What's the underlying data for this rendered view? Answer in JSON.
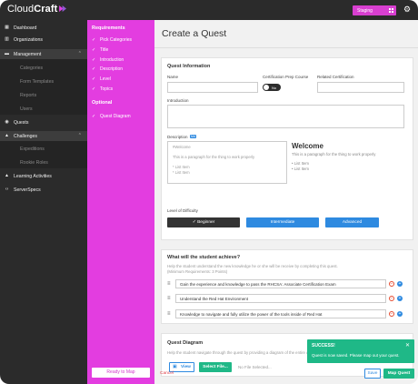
{
  "app": {
    "logo_light": "Cloud",
    "logo_bold": "Craft",
    "environment": "Staging",
    "colors": {
      "accent": "#e33de0",
      "primary": "#2e8ae0",
      "success": "#1fb887"
    }
  },
  "sidebar": {
    "items": [
      {
        "label": "Dashboard",
        "icon": "dashboard-icon"
      },
      {
        "label": "Organizations",
        "icon": "building-icon"
      },
      {
        "label": "Management",
        "icon": "folder-icon"
      },
      {
        "label": "Categories"
      },
      {
        "label": "Form Templates"
      },
      {
        "label": "Reports"
      },
      {
        "label": "Users"
      },
      {
        "label": "Quests",
        "icon": "compass-icon"
      },
      {
        "label": "Challenges",
        "icon": "mountain-icon"
      },
      {
        "label": "Expeditions"
      },
      {
        "label": "Rookie Roles"
      },
      {
        "label": "Learning Activities",
        "icon": "triangle-icon"
      },
      {
        "label": "ServerSpecs",
        "icon": "code-icon"
      }
    ]
  },
  "requirements": {
    "title": "Requirements",
    "items": [
      "Pick Categories",
      "Title",
      "Introduction",
      "Description",
      "Level",
      "Topics"
    ],
    "optional_title": "Optional",
    "optional_items": [
      "Quest Diagram"
    ],
    "ready_button": "Ready to Map"
  },
  "page": {
    "title": "Create a Quest"
  },
  "quest_info": {
    "heading": "Quest Information",
    "name_label": "Name",
    "cert_prep_label": "Certification Prep Course",
    "toggle_value": "No",
    "related_cert_label": "Related Certification",
    "intro_label": "Introduction",
    "description_label": "Description",
    "md_badge": "Md",
    "editor_lines": [
      "#Welcome",
      "This is a paragraph for the thing to work properly",
      "* List Item",
      "* List Item"
    ],
    "preview_heading": "Welcome",
    "preview_para": "This is a paragraph for the thing to work properly",
    "preview_list": [
      "• List Item",
      "• List Item"
    ],
    "level_label": "Level of Difficulty",
    "levels": [
      "Beginner",
      "Intermediate",
      "Advanced"
    ],
    "selected_level": "Beginner"
  },
  "achieve": {
    "heading": "What will the student achieve?",
    "help": "Help the student understand the new knowledge he or she will be receive by completing this quest.",
    "help2": "(Minimum Requirements: 3 Points)",
    "items": [
      "Gain the experience and knowledge to pass the RHCSA: Associate Certification Exam",
      "Understand the Red Hat Environment",
      "Knowledge to navigate and fully utilize the power of the tools inside of Red Hat"
    ]
  },
  "diagram": {
    "heading": "Quest Diagram",
    "help": "Help the student navigate through the quest by providing a diagram of the entire quest.",
    "view_button": "View",
    "select_button": "Select File...",
    "file_status": "No File Selected..."
  },
  "toast": {
    "title": "SUCCESS!",
    "message": "Quest is now saved. Please map out your quest."
  },
  "footer": {
    "cancel": "Cancel",
    "save": "Save",
    "map_quest": "Map Quest"
  }
}
